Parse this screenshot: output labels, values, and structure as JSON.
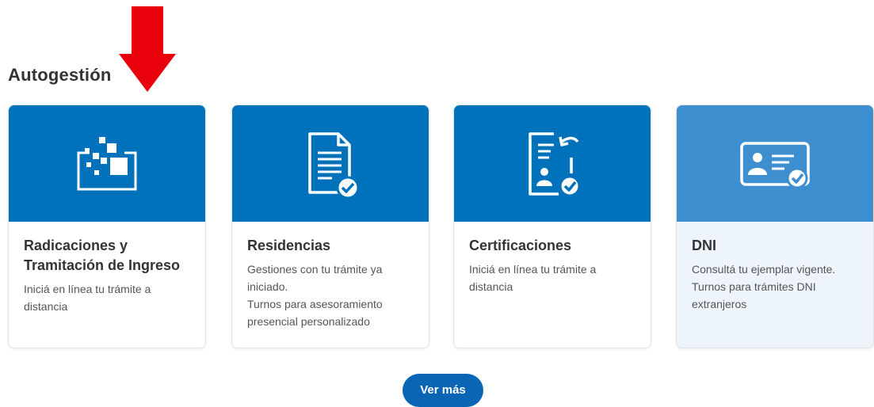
{
  "section": {
    "title": "Autogestión"
  },
  "cards": [
    {
      "icon": "data-transfer-icon",
      "title_line1": "Radicaciones y",
      "title_line2": "Tramitación de Ingreso",
      "desc_line1": "Iniciá en línea tu trámite a",
      "desc_line2": "distancia",
      "desc_line3": "",
      "desc_line4": ""
    },
    {
      "icon": "document-check-icon",
      "title_line1": "Residencias",
      "title_line2": "",
      "desc_line1": "Gestiones con tu trámite ya",
      "desc_line2": "iniciado.",
      "desc_line3": "Turnos para asesoramiento",
      "desc_line4": "presencial personalizado"
    },
    {
      "icon": "certificate-icon",
      "title_line1": "Certificaciones",
      "title_line2": "",
      "desc_line1": "Iniciá en línea tu trámite a",
      "desc_line2": "distancia",
      "desc_line3": "",
      "desc_line4": ""
    },
    {
      "icon": "id-card-icon",
      "title_line1": "DNI",
      "title_line2": "",
      "desc_line1": "Consultá tu ejemplar vigente.",
      "desc_line2": "Turnos para trámites DNI",
      "desc_line3": "extranjeros",
      "desc_line4": ""
    }
  ],
  "more_button": {
    "label": "Ver más"
  },
  "colors": {
    "card_header": "#0072bb",
    "card_header_dni": "#3e8fcf",
    "button": "#0a66b5",
    "arrow": "#e8000b"
  }
}
